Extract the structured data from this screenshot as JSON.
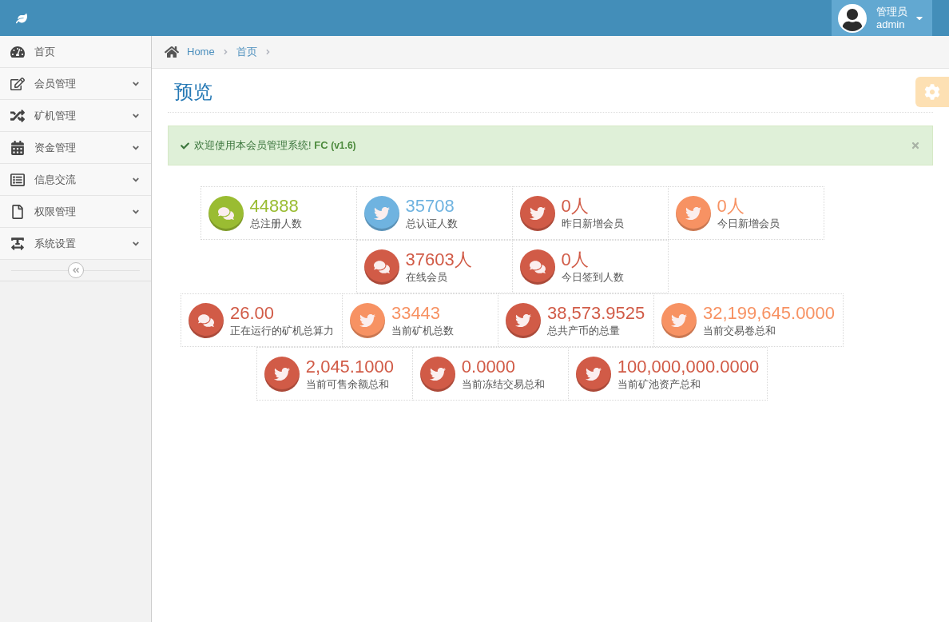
{
  "header": {
    "user": {
      "role": "管理员",
      "name": "admin"
    }
  },
  "sidebar": {
    "items": [
      {
        "label": "首页",
        "kind": "link"
      },
      {
        "label": "会员管理",
        "kind": "submenu"
      },
      {
        "label": "矿机管理",
        "kind": "submenu"
      },
      {
        "label": "资金管理",
        "kind": "submenu"
      },
      {
        "label": "信息交流",
        "kind": "submenu"
      },
      {
        "label": "权限管理",
        "kind": "submenu"
      },
      {
        "label": "系统设置",
        "kind": "submenu"
      }
    ]
  },
  "breadcrumbs": [
    {
      "label": "Home"
    },
    {
      "label": "首页"
    }
  ],
  "page_title": "预览",
  "alert": {
    "message": "欢迎使用本会员管理系统! **FC** **(v1.6)**"
  },
  "stat_rows": [
    [
      {
        "value": "44888",
        "label": "总注册人数",
        "kind": "chat",
        "color": "#9abc32"
      },
      {
        "value": "35708",
        "label": "总认证人数",
        "kind": "bird",
        "color": "#6fb3e0"
      },
      {
        "value": "0人",
        "label": "昨日新增会员",
        "kind": "bird",
        "color": "#d15b47"
      },
      {
        "value": "0人",
        "label": "今日新增会员",
        "kind": "bird",
        "color": "#f79263"
      }
    ],
    [
      {
        "value": "37603人",
        "label": "在线会员",
        "kind": "chat",
        "color": "#d15b47"
      },
      {
        "value": "0人",
        "label": "今日签到人数",
        "kind": "chat",
        "color": "#d15b47"
      }
    ],
    [
      {
        "value": "26.00",
        "label": "正在运行的矿机总算力",
        "kind": "chat",
        "color": "#d15b47"
      },
      {
        "value": "33443",
        "label": "当前矿机总数",
        "kind": "bird",
        "color": "#f79263"
      },
      {
        "value": "38,573.9525",
        "label": "总共产币的总量",
        "kind": "bird",
        "color": "#d15b47"
      },
      {
        "value": "32,199,645.0000",
        "label": "当前交易卷总和",
        "kind": "bird",
        "color": "#f79263"
      }
    ],
    [
      {
        "value": "2,045.1000",
        "label": "当前可售余额总和",
        "kind": "bird",
        "color": "#d15b47"
      },
      {
        "value": "0.0000",
        "label": "当前冻结交易总和",
        "kind": "bird",
        "color": "#d15b47"
      },
      {
        "value": "100,000,000.0000",
        "label": "当前矿池资产总和",
        "kind": "bird",
        "color": "#d15b47"
      }
    ]
  ]
}
